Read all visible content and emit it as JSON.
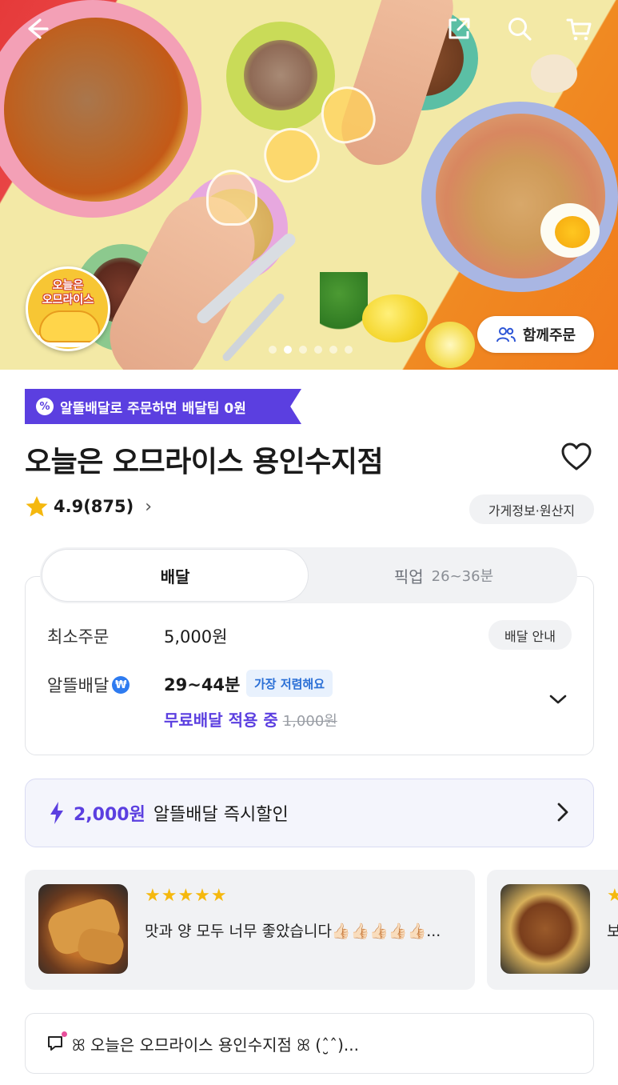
{
  "hero": {
    "carousel_total": 6,
    "carousel_active_index": 2,
    "logo_text_line1": "오늘은",
    "logo_text_line2": "오므라이스",
    "group_order_label": "함께주문"
  },
  "promo_tag": {
    "badge_symbol": "%",
    "text": "알뜰배달로 주문하면 배달팁 0원"
  },
  "store": {
    "name": "오늘은 오므라이스 용인수지점",
    "rating": "4.9(875)",
    "rating_chevron": "›",
    "info_label": "가게정보·원산지"
  },
  "tabs": {
    "delivery_label": "배달",
    "pickup_label": "픽업",
    "pickup_time": "26~36분"
  },
  "delivery": {
    "min_order_label": "최소주문",
    "min_order_value": "5,000원",
    "guide_label": "배달 안내",
    "saver_label": "알뜰배달",
    "saver_badge": "₩",
    "eta": "29~44분",
    "cheapest_badge": "가장 저렴해요",
    "free_delivery_text": "무료배달 적용 중",
    "original_fee": "1,000원"
  },
  "instant_discount": {
    "amount": "2,000원",
    "text": "알뜰배달 즉시할인"
  },
  "reviews": [
    {
      "stars": "★★★★★",
      "text": "맛과 양 모두 너무 좋았습니다👍🏻👍🏻👍🏻👍🏻👍🏻..."
    },
    {
      "stars": "★",
      "text": "보 보"
    }
  ],
  "notice": {
    "text": "ꕤ 오늘은 오므라이스 용인수지점 ꕤ (ˆ̮ˆ)..."
  },
  "colors": {
    "brand_purple": "#5b3fe0",
    "star_yellow": "#f5b80e",
    "badge_blue": "#2a6fd6"
  },
  "icons": [
    "back-arrow-icon",
    "share-icon",
    "search-icon",
    "cart-icon",
    "group-icon",
    "heart-icon",
    "star-icon",
    "chevron-down-icon",
    "lightning-icon",
    "chevron-right-icon",
    "notice-icon"
  ]
}
